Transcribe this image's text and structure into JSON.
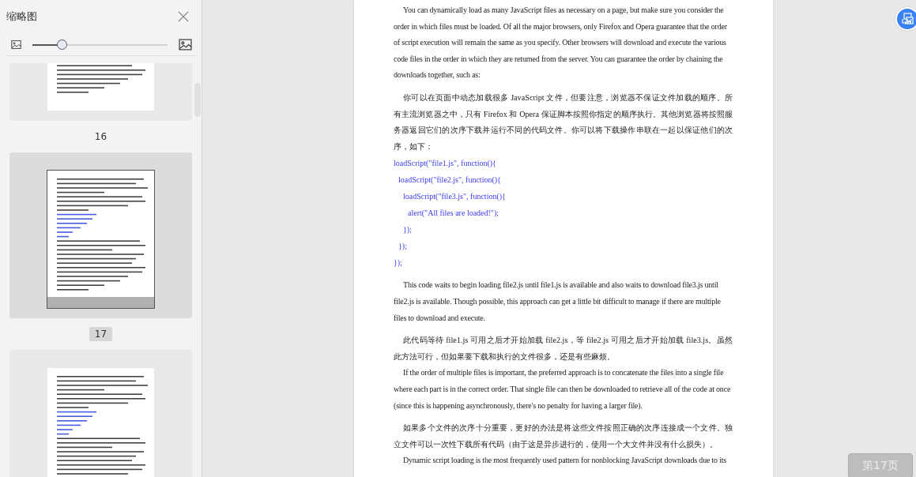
{
  "sidebar": {
    "title": "缩略图",
    "zoom_slider": {
      "level": 0.225
    },
    "pages": [
      {
        "label": "16",
        "selected": false
      },
      {
        "label": "17",
        "selected": true
      },
      {
        "selected": false
      }
    ]
  },
  "document": {
    "sections": [
      [
        {
          "kind": "en",
          "text": "You can dynamically load as many JavaScript files as necessary on a page, but make sure you consider the order in which files must be loaded. Of all the major browsers, only Firefox and Opera guarantee that the order of script execution will remain the same as you specify. Other browsers will download and execute the various code files in the order in which they are returned from the server. You can guarantee the order by chaining the downloads together, such as:"
        }
      ],
      [
        {
          "kind": "zh",
          "text": "你可以在页面中动态加载很多 JavaScript 文件，但要注意，浏览器不保证文件加载的顺序。所有主流浏览器之中，只有 Firefox 和 Opera 保证脚本按照你指定的顺序执行。其他浏览器将按照服务器返回它们的次序下载并运行不同的代码文件。你可以将下载操作串联在一起以保证他们的次序，如下："
        },
        {
          "kind": "code",
          "lines": [
            {
              "line": "loadScript(\"file1.js\", function(){",
              "children": [
                {
                  "line": "loadScript(\"file2.js\", function(){",
                  "children": [
                    {
                      "line": "loadScript(\"file3.js\", function(){",
                      "children": [
                        {
                          "line": "alert(\"All files are loaded!\");"
                        }
                      ]
                    },
                    {
                      "line": "});"
                    }
                  ]
                },
                {
                  "line": "});"
                }
              ]
            },
            {
              "line": "});"
            }
          ]
        }
      ],
      [
        {
          "kind": "en",
          "text": "This code waits to begin loading file2.js until file1.js is available and also waits to download file3.js until file2.js is available. Though possible, this approach can get a little bit difficult to manage if there are multiple files to download and execute."
        }
      ],
      [
        {
          "kind": "zh",
          "text": "此代码等待 file1.js 可用之后才开始加载 file2.js，等 file2.js 可用之后才开始加载 file3.js。虽然此方法可行，但如果要下载和执行的文件很多，还是有些麻烦。"
        },
        {
          "kind": "en",
          "text": "If the order of multiple files is important, the preferred approach is to concatenate the files into a single file where each part is in the correct order. That single file can then be downloaded to retrieve all of the code at once (since this is happening asynchronously, there's no penalty for having a larger file)."
        }
      ],
      [
        {
          "kind": "zh",
          "text": "如果多个文件的次序十分重要，更好的办法是将这些文件按照正确的次序连接成一个文件。独立文件可以一次性下载所有代码（由于这是异步进行的，使用一个大文件并没有什么损失）。"
        },
        {
          "kind": "en",
          "text": "Dynamic script loading is the most frequently used pattern for nonblocking JavaScript downloads due to its"
        }
      ]
    ]
  },
  "page_indicator": "第17页"
}
